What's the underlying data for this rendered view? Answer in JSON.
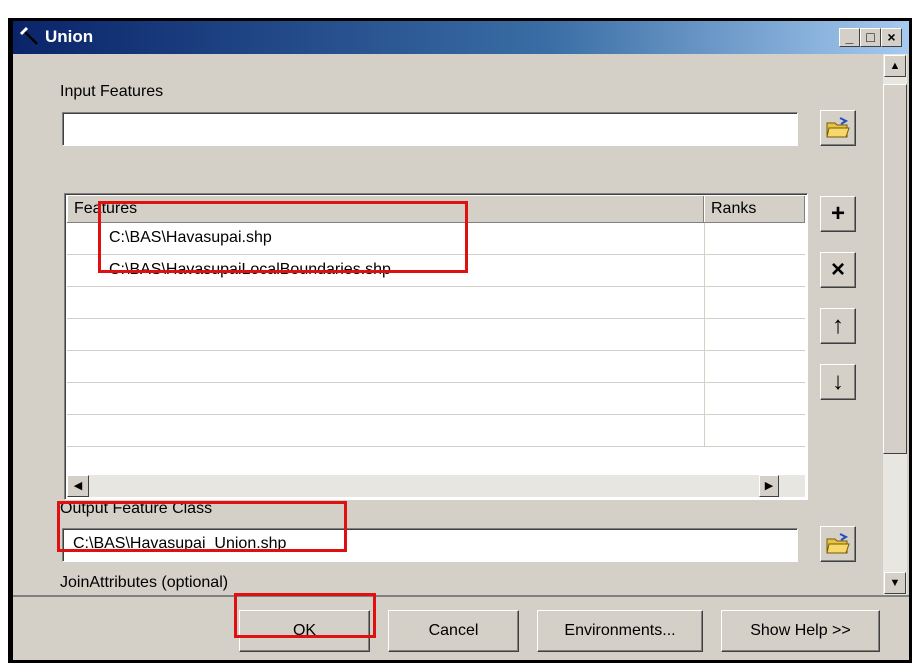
{
  "window": {
    "title": "Union",
    "minimize_label": "_",
    "maximize_label": "□",
    "close_label": "×"
  },
  "form": {
    "input_features_label": "Input Features",
    "input_features_value": "",
    "features_header": "Features",
    "ranks_header": "Ranks",
    "features_rows": [
      "C:\\BAS\\Havasupai.shp",
      "C:\\BAS\\HavasupaiLocalBoundaries.shp",
      "",
      "",
      "",
      "",
      ""
    ],
    "output_label": "Output Feature Class",
    "output_value": "C:\\BAS\\Havasupai_Union.shp",
    "join_label": "JoinAttributes (optional)"
  },
  "side_buttons": {
    "add": "+",
    "remove": "×",
    "up": "↑",
    "down": "↓"
  },
  "buttons": {
    "ok": "OK",
    "cancel": "Cancel",
    "environments": "Environments...",
    "show_help": "Show Help >>"
  },
  "colors": {
    "highlight": "#e01010",
    "title_bar": "#0a246a"
  }
}
